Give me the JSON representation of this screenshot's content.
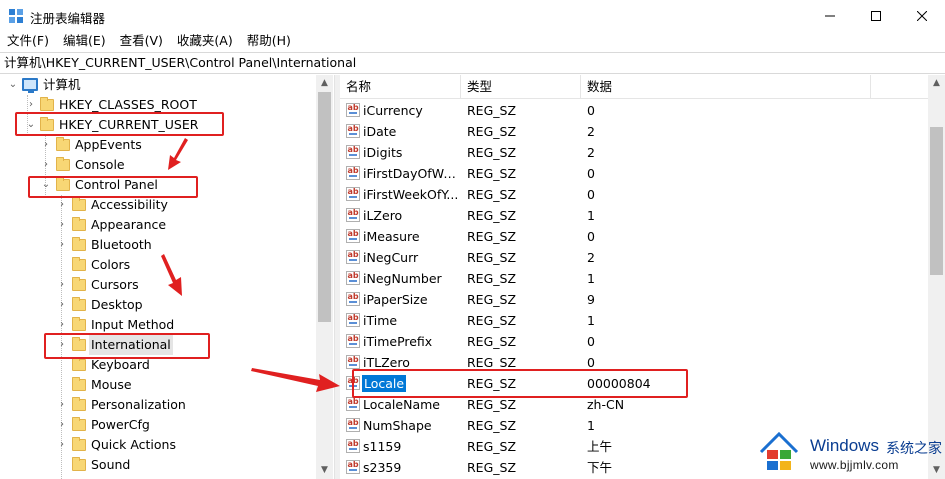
{
  "window": {
    "title": "注册表编辑器",
    "controls": {
      "minimize": "minimize-icon",
      "maximize": "maximize-icon",
      "close": "close-icon"
    }
  },
  "menu": [
    "文件(F)",
    "编辑(E)",
    "查看(V)",
    "收藏夹(A)",
    "帮助(H)"
  ],
  "address": "计算机\\HKEY_CURRENT_USER\\Control Panel\\International",
  "tree": {
    "root": "计算机",
    "items": [
      {
        "label": "HKEY_CLASSES_ROOT",
        "expanded": false
      },
      {
        "label": "HKEY_CURRENT_USER",
        "expanded": true
      },
      {
        "label": "AppEvents",
        "expanded": false
      },
      {
        "label": "Console",
        "expanded": false
      },
      {
        "label": "Control Panel",
        "expanded": true
      },
      {
        "label": "Accessibility",
        "expanded": false
      },
      {
        "label": "Appearance",
        "expanded": false
      },
      {
        "label": "Bluetooth",
        "expanded": false
      },
      {
        "label": "Colors",
        "expanded": false
      },
      {
        "label": "Cursors",
        "expanded": false
      },
      {
        "label": "Desktop",
        "expanded": false
      },
      {
        "label": "Input Method",
        "expanded": false
      },
      {
        "label": "International",
        "expanded": false,
        "selected": true
      },
      {
        "label": "Keyboard",
        "expanded": false
      },
      {
        "label": "Mouse",
        "expanded": false
      },
      {
        "label": "Personalization",
        "expanded": false
      },
      {
        "label": "PowerCfg",
        "expanded": false
      },
      {
        "label": "Quick Actions",
        "expanded": false
      },
      {
        "label": "Sound",
        "expanded": false
      }
    ]
  },
  "list": {
    "headers": {
      "name": "名称",
      "type": "类型",
      "data": "数据"
    },
    "rows": [
      {
        "name": "iCurrency",
        "type": "REG_SZ",
        "data": "0"
      },
      {
        "name": "iDate",
        "type": "REG_SZ",
        "data": "2"
      },
      {
        "name": "iDigits",
        "type": "REG_SZ",
        "data": "2"
      },
      {
        "name": "iFirstDayOfWeek",
        "type": "REG_SZ",
        "data": "0"
      },
      {
        "name": "iFirstWeekOfY...",
        "type": "REG_SZ",
        "data": "0"
      },
      {
        "name": "iLZero",
        "type": "REG_SZ",
        "data": "1"
      },
      {
        "name": "iMeasure",
        "type": "REG_SZ",
        "data": "0"
      },
      {
        "name": "iNegCurr",
        "type": "REG_SZ",
        "data": "2"
      },
      {
        "name": "iNegNumber",
        "type": "REG_SZ",
        "data": "1"
      },
      {
        "name": "iPaperSize",
        "type": "REG_SZ",
        "data": "9"
      },
      {
        "name": "iTime",
        "type": "REG_SZ",
        "data": "1"
      },
      {
        "name": "iTimePrefix",
        "type": "REG_SZ",
        "data": "0"
      },
      {
        "name": "iTLZero",
        "type": "REG_SZ",
        "data": "0"
      },
      {
        "name": "Locale",
        "type": "REG_SZ",
        "data": "00000804",
        "selected": true
      },
      {
        "name": "LocaleName",
        "type": "REG_SZ",
        "data": "zh-CN"
      },
      {
        "name": "NumShape",
        "type": "REG_SZ",
        "data": "1"
      },
      {
        "name": "s1159",
        "type": "REG_SZ",
        "data": "上午"
      },
      {
        "name": "s2359",
        "type": "REG_SZ",
        "data": "下午"
      }
    ]
  },
  "annotation_color": "#e02020",
  "watermark": {
    "brand": "Windows",
    "brand_cn": "系统之家",
    "url": "www.bjjmlv.com"
  }
}
